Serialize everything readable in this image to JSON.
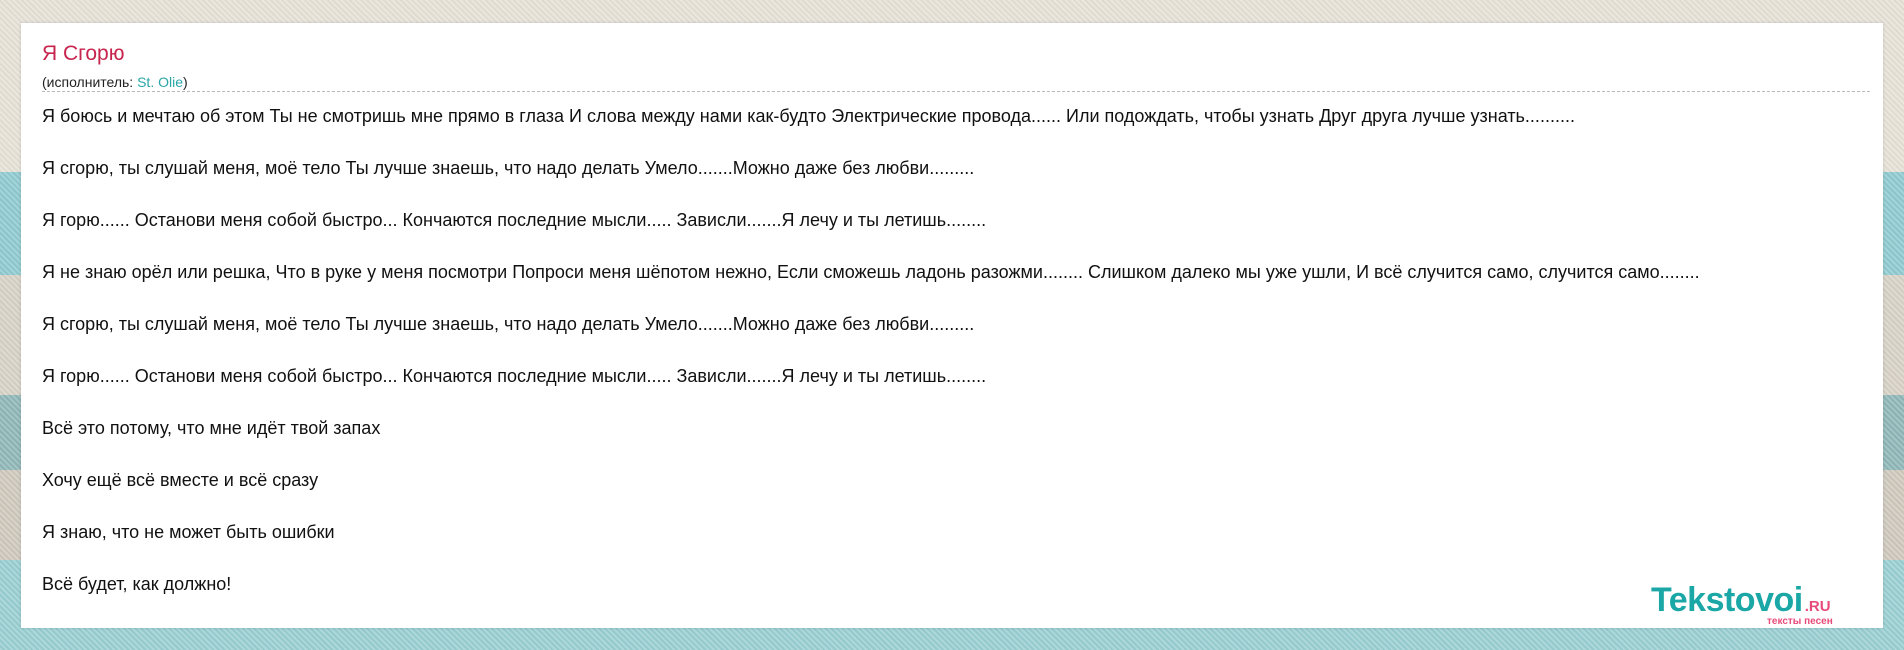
{
  "song": {
    "title": "Я Сгорю",
    "performer_prefix": "(исполнитель: ",
    "performer_name": "St. Olie",
    "performer_suffix": ")"
  },
  "lyrics": [
    "Я боюсь и мечтаю об этом Ты не смотришь мне прямо в глаза И слова между нами как-будто Электрические провода...... Или подождать, чтобы узнать Друг друга лучше узнать..........",
    "Я сгорю, ты слушай меня, моё тело Ты лучше знаешь, что надо делать Умело.......Можно даже без любви.........",
    "Я горю...... Останови меня собой быстро... Кончаются последние мысли..... Зависли.......Я лечу и ты летишь........",
    "Я не знаю орёл или решка, Что в руке у меня посмотри Попроси меня шёпотом нежно, Если сможешь ладонь разожми........ Слишком далеко мы уже ушли, И всё случится само, случится само........",
    "Я сгорю, ты слушай меня, моё тело Ты лучше знаешь, что надо делать Умело.......Можно даже без любви.........",
    "Я горю...... Останови меня собой быстро... Кончаются последние мысли..... Зависли.......Я лечу и ты летишь........",
    "Всё это потому, что мне идёт твой запах",
    "Хочу ещё всё вместе и всё сразу",
    "Я знаю, что не может быть ошибки",
    "Всё будет, как должно!"
  ],
  "logo": {
    "main": "Tekstovoi",
    "tld": ".RU",
    "tagline": "тексты песен"
  },
  "colors": {
    "title": "#c7254e",
    "link": "#2aa6a8",
    "logo_main": "#1aa7a6",
    "logo_accent": "#e74b7a"
  }
}
